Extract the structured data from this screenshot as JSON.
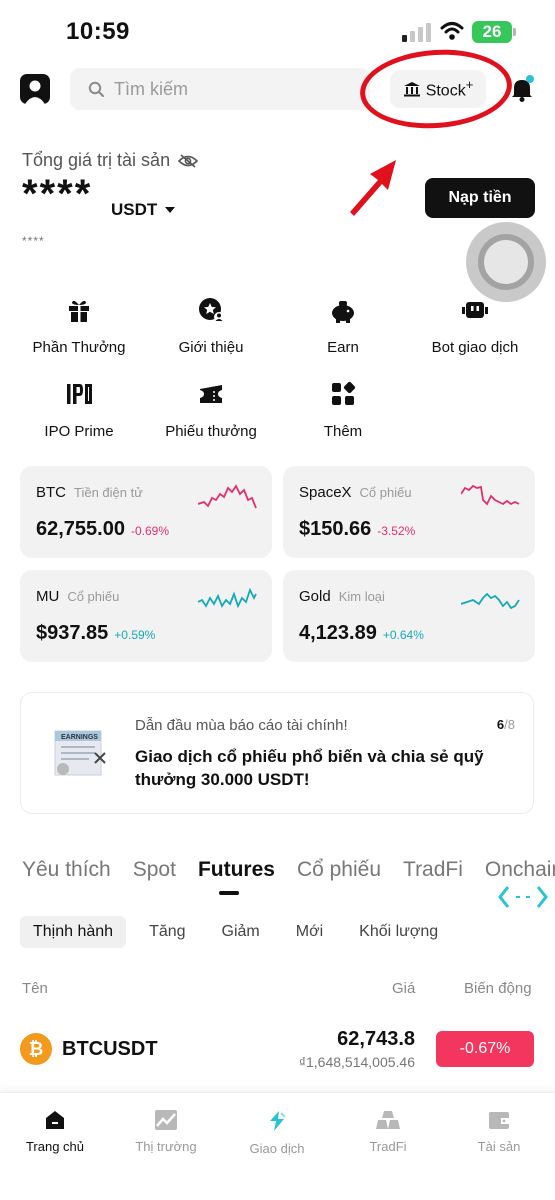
{
  "status_bar": {
    "time": "10:59",
    "battery": "26"
  },
  "header": {
    "search_placeholder": "Tìm kiếm",
    "stock_label": "Stock",
    "stock_plus": "+"
  },
  "asset": {
    "label": "Tổng giá trị tài sản",
    "value": "****",
    "unit": "USDT",
    "sub": "****",
    "deposit_label": "Nạp tiền"
  },
  "shortcuts": [
    {
      "label": "Phần Thưởng",
      "icon": "gift-icon"
    },
    {
      "label": "Giới thiệu",
      "icon": "referral-icon"
    },
    {
      "label": "Earn",
      "icon": "piggy-bank-icon"
    },
    {
      "label": "Bot giao dịch",
      "icon": "bot-icon"
    },
    {
      "label": "IPO Prime",
      "icon": "ipo-icon"
    },
    {
      "label": "Phiếu thưởng",
      "icon": "voucher-icon"
    },
    {
      "label": "Thêm",
      "icon": "more-grid-icon"
    }
  ],
  "tickers": [
    {
      "symbol": "BTC",
      "category": "Tiền điện tử",
      "price": "62,755.00",
      "change": "-0.69%",
      "color": "#e0306b"
    },
    {
      "symbol": "SpaceX",
      "category": "Cổ phiếu",
      "price": "$150.66",
      "change": "-3.52%",
      "color": "#e0306b"
    },
    {
      "symbol": "MU",
      "category": "Cổ phiếu",
      "price": "$937.85",
      "change": "+0.59%",
      "color": "#14a9b8"
    },
    {
      "symbol": "Gold",
      "category": "Kim loại",
      "price": "4,123.89",
      "change": "+0.64%",
      "color": "#14a9b8"
    }
  ],
  "promo": {
    "title": "Dẫn đầu mùa báo cáo tài chính!",
    "page_current": "6",
    "page_total": "/8",
    "body": "Giao dịch cổ phiếu phổ biến và chia sẻ quỹ thưởng 30.000 USDT!",
    "badge": "EARNINGS"
  },
  "market_tabs": [
    "Yêu thích",
    "Spot",
    "Futures",
    "Cổ phiếu",
    "TradFi",
    "Onchain"
  ],
  "market_tab_active": "Futures",
  "sub_tabs": [
    "Thịnh hành",
    "Tăng",
    "Giảm",
    "Mới",
    "Khối lượng"
  ],
  "columns": {
    "name": "Tên",
    "price": "Giá",
    "change": "Biến động"
  },
  "rows": [
    {
      "symbol": "BTCUSDT",
      "price": "62,743.8",
      "sub_price": "₫1,648,514,005.46",
      "change": "-0.67%"
    }
  ],
  "bottom_nav": [
    {
      "label": "Trang chủ",
      "icon": "home-icon"
    },
    {
      "label": "Thị trường",
      "icon": "market-chart-icon"
    },
    {
      "label": "Giao dịch",
      "icon": "trade-icon"
    },
    {
      "label": "TradFi",
      "icon": "gold-bars-icon"
    },
    {
      "label": "Tài sản",
      "icon": "wallet-icon"
    }
  ],
  "colors": {
    "negative": "#e0306b",
    "positive": "#14a9b8",
    "accent": "#28c4d4",
    "annotation": "#e0101d"
  }
}
